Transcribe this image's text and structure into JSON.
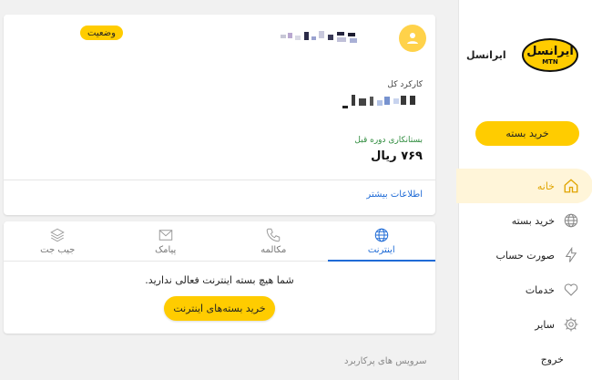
{
  "colors": {
    "brand": "#ffcc00",
    "link": "#1f6bd6",
    "positive": "#2e8b3d"
  },
  "brand": {
    "logo_text": "ایرانسل",
    "logo_sub": "MTN",
    "name": "ایرانسل"
  },
  "sidebar": {
    "buy_button": "خرید بسته",
    "items": [
      {
        "label": "خانه",
        "icon": "home-icon",
        "active": true
      },
      {
        "label": "خرید بسته",
        "icon": "globe-icon",
        "active": false
      },
      {
        "label": "صورت حساب",
        "icon": "bolt-icon",
        "active": false
      },
      {
        "label": "خدمات",
        "icon": "heart-icon",
        "active": false
      },
      {
        "label": "سایر",
        "icon": "gear-icon",
        "active": false
      }
    ],
    "logout": "خروج"
  },
  "account": {
    "status_badge": "وضعیت",
    "usage_label": "کارکرد کل",
    "debt_label": "بستانکاری دوره قبل",
    "debt_value": "۷۶۹ ریال",
    "more_link": "اطلاعات بیشتر"
  },
  "tabs": [
    {
      "label": "اینترنت",
      "icon": "globe-icon",
      "active": true
    },
    {
      "label": "مکالمه",
      "icon": "phone-icon",
      "active": false
    },
    {
      "label": "پیامک",
      "icon": "envelope-icon",
      "active": false
    },
    {
      "label": "جیب جت",
      "icon": "layers-icon",
      "active": false
    }
  ],
  "internet": {
    "empty_message": "شما هیچ بسته اینترنت فعالی ندارید.",
    "buy_button": "خرید بسته‌های اینترنت"
  },
  "section": {
    "title": "سرویس های پرکاربرد"
  }
}
